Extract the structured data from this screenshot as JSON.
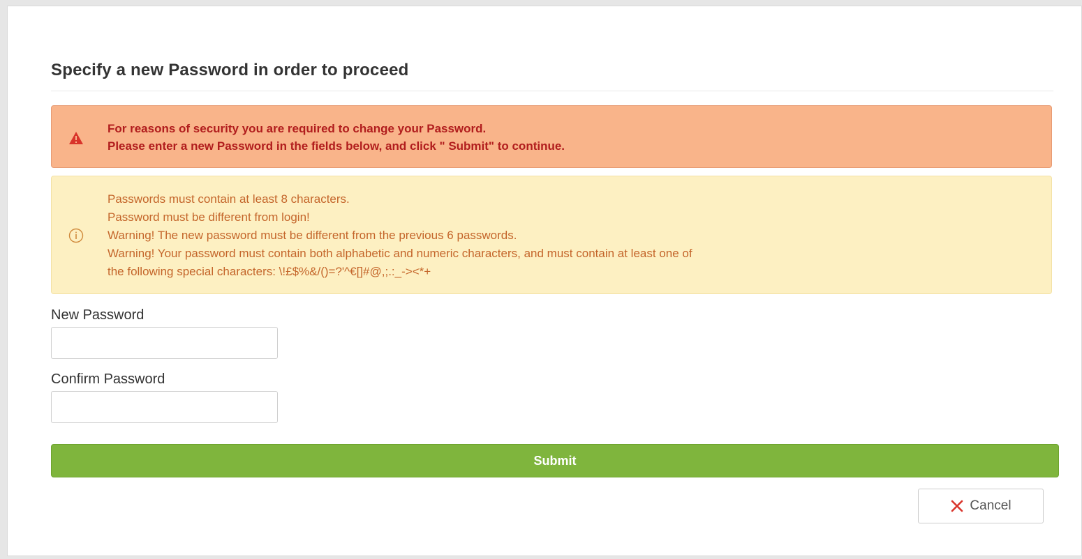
{
  "title": "Specify a new Password in order to proceed",
  "security_alert": {
    "icon": "warning-triangle-icon",
    "line1": "For reasons of security you are required to change your Password.",
    "line2": "Please enter a new Password in the fields below, and click \" Submit\" to continue."
  },
  "rules_alert": {
    "icon": "info-circle-icon",
    "lines": [
      "Passwords must contain at least 8 characters.",
      "Password must be different from login!",
      "Warning! The new password must be different from the previous 6 passwords.",
      "Warning! Your password must contain both alphabetic and numeric characters, and must contain at least one of",
      "the following special characters: \\!£$%&/()=?'^€[]#@,;.:_-><*+"
    ]
  },
  "form": {
    "new_password_label": "New Password",
    "new_password_value": "",
    "confirm_password_label": "Confirm Password",
    "confirm_password_value": ""
  },
  "actions": {
    "submit_label": "Submit",
    "cancel_label": "Cancel",
    "cancel_icon": "close-icon"
  },
  "colors": {
    "danger_bg": "#f9b48a",
    "danger_text": "#b11d1d",
    "warning_bg": "#fdf0c2",
    "warning_text": "#c4652a",
    "submit_bg": "#7fb53d",
    "cancel_icon": "#d9342b"
  }
}
